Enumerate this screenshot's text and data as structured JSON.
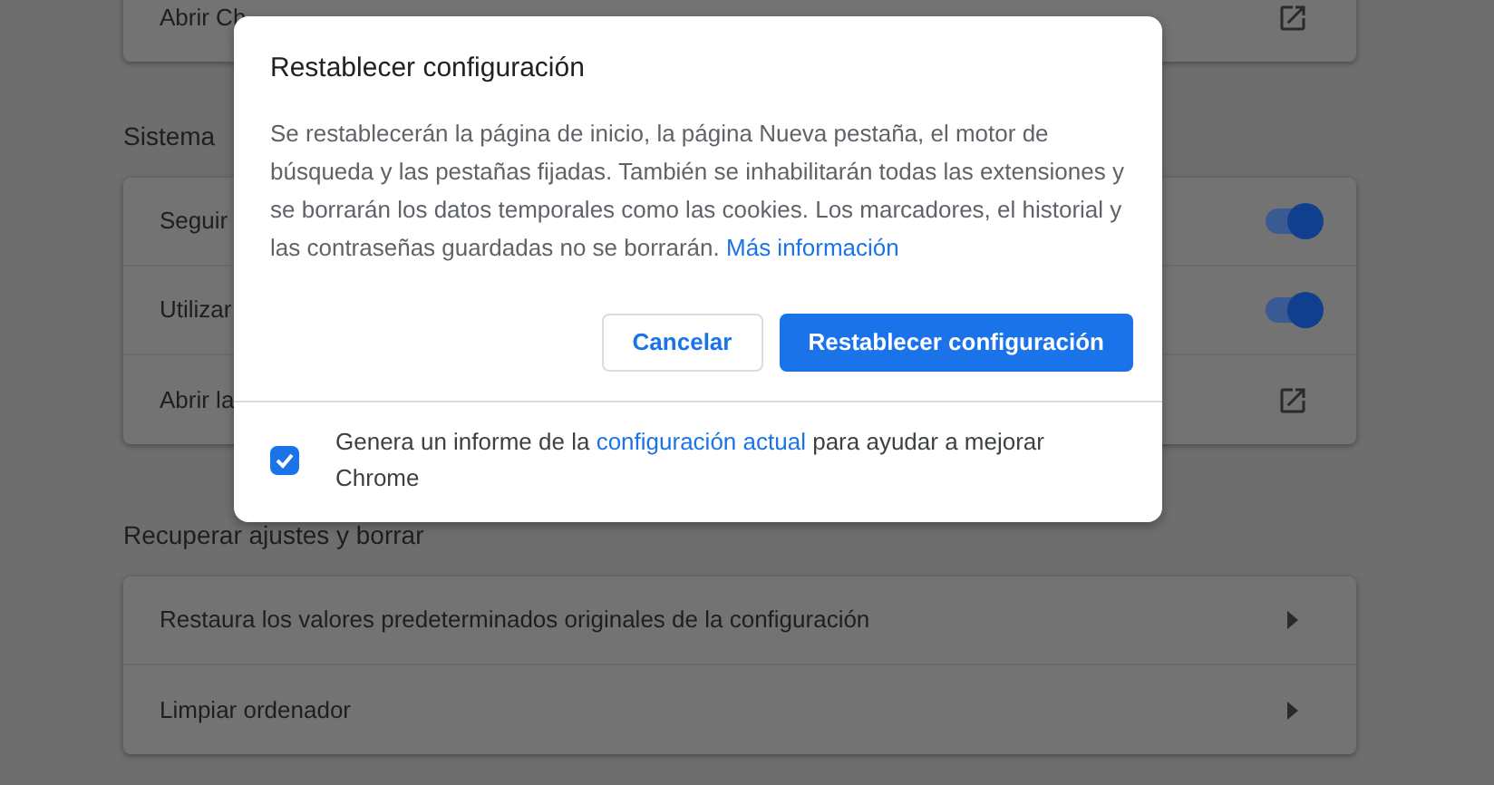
{
  "top_card": {
    "rows": [
      {
        "kind": "link",
        "label": "Abrir Ch"
      }
    ]
  },
  "sections": [
    {
      "heading": "Sistema",
      "rows": [
        {
          "kind": "toggle",
          "label": "Seguir",
          "on": true
        },
        {
          "kind": "toggle",
          "label": "Utilizar",
          "on": true
        },
        {
          "kind": "link",
          "label": "Abrir la"
        }
      ]
    },
    {
      "heading": "Recuperar ajustes y borrar",
      "rows": [
        {
          "kind": "arrow",
          "label": "Restaura los valores predeterminados originales de la configuración"
        },
        {
          "kind": "arrow",
          "label": "Limpiar ordenador"
        }
      ]
    }
  ],
  "dialog": {
    "title": "Restablecer configuración",
    "body": "Se restablecerán la página de inicio, la página Nueva pestaña, el motor de búsqueda y las pestañas fijadas. También se inhabilitarán todas las extensiones y se borrarán los datos temporales como las cookies. Los marcadores, el historial y las contraseñas guardadas no se borrarán.",
    "body_link": "Más información",
    "cancel": "Cancelar",
    "confirm": "Restablecer configuración",
    "report": {
      "checked": true,
      "before": "Genera un informe de la",
      "link": "configuración actual",
      "after": "para ayudar a mejorar Chrome"
    }
  }
}
